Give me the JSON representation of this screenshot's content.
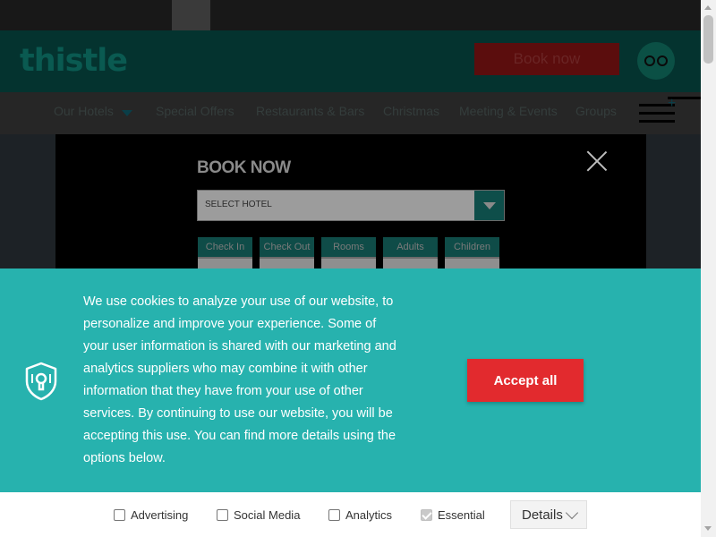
{
  "header": {
    "logo": "thistle",
    "book_now": "Book now",
    "tripadvisor_icon": "tripadvisor-owl-icon"
  },
  "nav": {
    "items": [
      "Our Hotels",
      "Special Offers",
      "Restaurants & Bars",
      "Christmas",
      "Meeting & Events",
      "Groups"
    ],
    "menu_icon": "hamburger-plus-icon"
  },
  "booking": {
    "title": "BOOK NOW",
    "select_hotel": "SELECT HOTEL",
    "fields": [
      "Check In",
      "Check Out",
      "Rooms",
      "Adults",
      "Children"
    ]
  },
  "cookie": {
    "icon": "shield-keyhole-icon",
    "text": "We use cookies to analyze your use of our website, to personalize and improve your experience. Some of your user information is shared with our marketing and analytics suppliers who may combine it with other information that they have from your use of other services. By continuing to use our website, you will be accepting this use. You can find more details using the options below.",
    "accept_label": "Accept all",
    "accept_color": "#e22a2e",
    "banner_color": "#27b2ae",
    "options": [
      {
        "label": "Advertising",
        "checked": false
      },
      {
        "label": "Social Media",
        "checked": false
      },
      {
        "label": "Analytics",
        "checked": false
      },
      {
        "label": "Essential",
        "checked": true,
        "disabled": true
      }
    ],
    "details_label": "Details"
  }
}
